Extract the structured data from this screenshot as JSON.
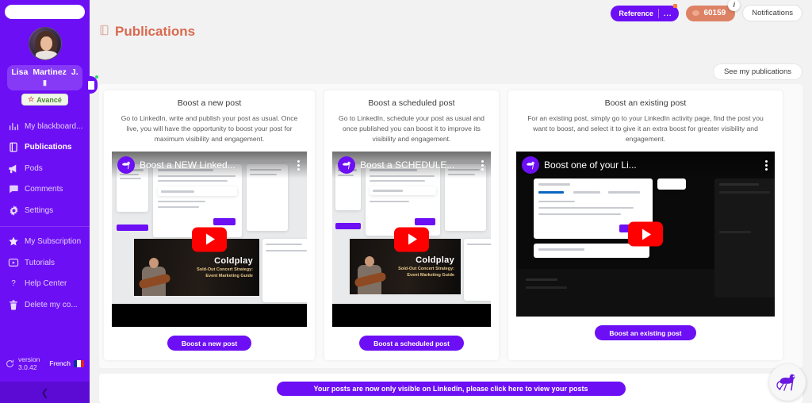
{
  "sidebar": {
    "search_placeholder": "",
    "user": {
      "first_name": "Lisa",
      "last_name": "Martinez",
      "initial": "J.",
      "badge_label": "Avancé",
      "badge_icon": "star-icon"
    },
    "items": [
      {
        "label": "My blackboard...",
        "icon": "chart-bar-icon",
        "active": false
      },
      {
        "label": "Publications",
        "icon": "document-icon",
        "active": true
      },
      {
        "label": "Pods",
        "icon": "megaphone-icon",
        "active": false
      },
      {
        "label": "Comments",
        "icon": "comment-icon",
        "active": false
      },
      {
        "label": "Settings",
        "icon": "gear-icon",
        "active": false
      },
      {
        "label": "My Subscription",
        "icon": "star-icon",
        "active": false
      },
      {
        "label": "Tutorials",
        "icon": "video-icon",
        "active": false
      },
      {
        "label": "Help Center",
        "icon": "question-mark-icon",
        "active": false
      },
      {
        "label": "Delete my co...",
        "icon": "trash-icon",
        "active": false
      }
    ],
    "footer": {
      "version_line1": "version",
      "version_line2": "3.0.42",
      "language": "French",
      "flag": "fr-flag-icon"
    },
    "collapse_icon": "chevron-left-icon"
  },
  "header": {
    "title": "Publications",
    "title_icon": "document-icon",
    "reference_button": "Reference",
    "reference_dots": "...",
    "credits_value": "60159",
    "credits_icon": "coin-icon",
    "info_icon": "i",
    "notifications_button": "Notifications",
    "see_publications_button": "See my publications"
  },
  "cards": [
    {
      "title": "Boost a new post",
      "description": "Go to LinkedIn, write and publish your post as usual. Once live, you will have the opportunity to boost your post for maximum visibility and engagement.",
      "video_title": "Boost a NEW Linked...",
      "video_channel_icon": "ostrich-avatar-icon",
      "video_menu_icon": "kebab-menu-icon",
      "play_icon": "play-icon",
      "button": "Boost a new post",
      "overlay_title": "Coldplay",
      "overlay_subtitle": "Sold-Out Concert Strategy:\nEvent Marketing Guide"
    },
    {
      "title": "Boost a scheduled post",
      "description": "Go to LinkedIn, schedule your post as usual and once published you can boost it to improve its visibility and engagement.",
      "video_title": "Boost a SCHEDULE...",
      "video_channel_icon": "ostrich-avatar-icon",
      "video_menu_icon": "kebab-menu-icon",
      "play_icon": "play-icon",
      "button": "Boost a scheduled post",
      "overlay_title": "Coldplay",
      "overlay_subtitle": "Sold-Out Concert Strategy:\nEvent Marketing Guide"
    },
    {
      "title": "Boost an existing post",
      "description": "For an existing post, simply go to your LinkedIn activity page, find the post you want to boost, and select it to give it an extra boost for greater visibility and engagement.",
      "video_title": "Boost one of your Li...",
      "video_channel_icon": "ostrich-avatar-icon",
      "video_menu_icon": "kebab-menu-icon",
      "play_icon": "play-icon",
      "button": "Boost an existing post",
      "overlay_title": "",
      "overlay_subtitle": ""
    }
  ],
  "bottom_banner": {
    "label": "Your posts are now only visible on Linkedin, please click here to view your posts"
  },
  "mascot": {
    "icon": "ostrich-mascot-icon"
  },
  "colors": {
    "brand_purple": "#6d0ff5",
    "title_orange": "#d96a4e",
    "credits_orange": "#dd8264",
    "play_red": "#ff0000",
    "page_bg": "#f2f2f3"
  }
}
